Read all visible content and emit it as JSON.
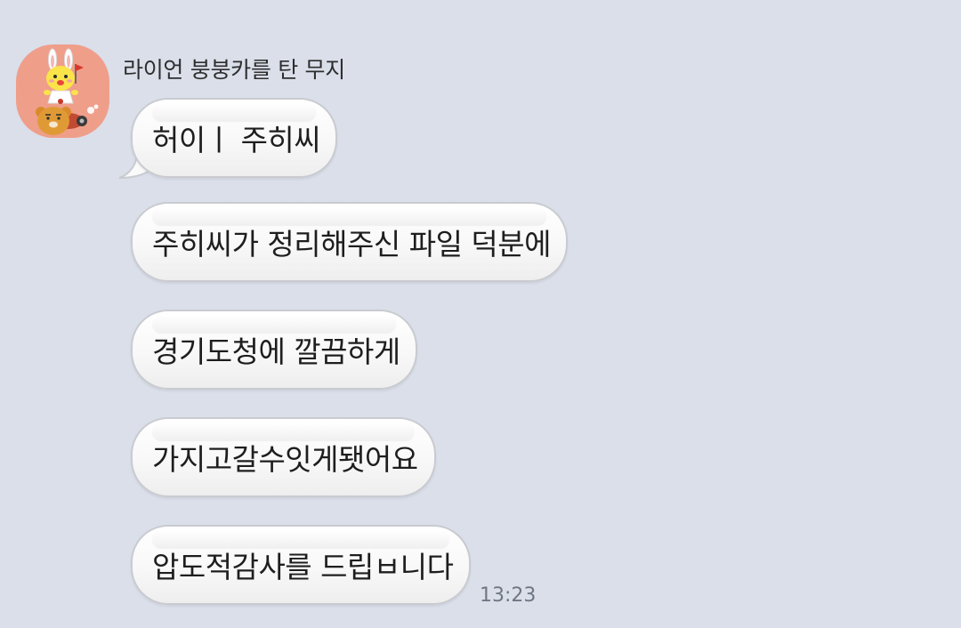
{
  "sender": {
    "name": "라이언 붕붕카를 탄 무지",
    "avatar_icon": "muzi-riding-ryan-car-icon",
    "avatar_bg": "#ef9e8a"
  },
  "messages": [
    {
      "text": "허이ㅣ  주히씨"
    },
    {
      "text": "주히씨가 정리해주신 파일 덕분에"
    },
    {
      "text": "경기도청에 깔끔하게"
    },
    {
      "text": "가지고갈수잇게됏어요"
    },
    {
      "text": "압도적감사를 드립ㅂ니다"
    }
  ],
  "timestamp": "13:23",
  "colors": {
    "background": "#dadfea",
    "bubble": "#ffffff",
    "bubble_border": "#c9cbd0"
  }
}
